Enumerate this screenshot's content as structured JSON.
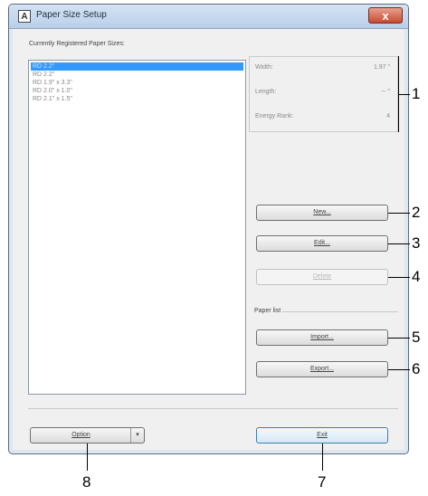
{
  "window": {
    "title": "Paper Size Setup",
    "icon_letter": "A",
    "close_label": "x"
  },
  "list": {
    "header": "Currently Registered Paper Sizes:",
    "items": [
      "RD 2.2\"",
      "RD 2.2\"",
      "RD 1.9\" x 3.3\"",
      "RD 2.0\" x 1.0\"",
      "RD 2.1\" x 1.5\""
    ]
  },
  "info": {
    "width_label": "Width:",
    "width_value": "1.97 \"",
    "length_label": "Length:",
    "length_value": "-- \"",
    "energy_label": "Energy Rank:",
    "energy_value": "4"
  },
  "buttons": {
    "new": "New...",
    "edit": "Edit...",
    "delete": "Delete",
    "paper_list_label": "Paper list",
    "import": "Import...",
    "export": "Export...",
    "option": "Option",
    "exit": "Exit"
  },
  "callouts": [
    "1",
    "2",
    "3",
    "4",
    "5",
    "6",
    "7",
    "8"
  ]
}
